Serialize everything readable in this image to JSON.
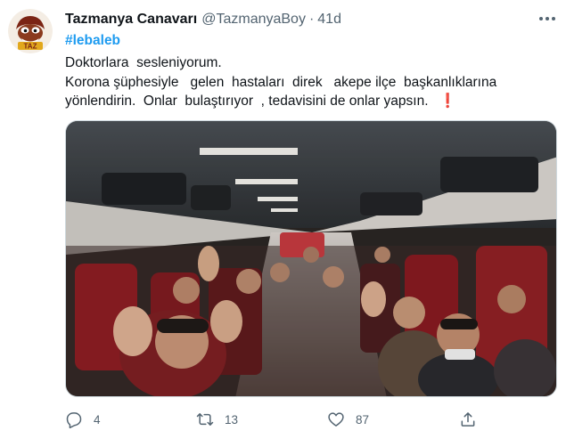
{
  "tweet": {
    "display_name": "Tazmanya Canavarı",
    "handle": "@TazmanyaBoy",
    "separator": "·",
    "time": "41d",
    "hashtag": "#lebaleb",
    "lines": [
      "Doktorlara  sesleniyorum.",
      "Korona şüphesiyle   gelen  hastaları  direk   akepe ilçe  başkanlıklarına",
      "yönlendirin.  Onlar  bulaştırıyor  , tedavisini de onlar yapsın."
    ],
    "emoji": "❗",
    "avatar_text": "TAZ"
  },
  "actions": {
    "reply_count": "4",
    "retweet_count": "13",
    "like_count": "87"
  },
  "icons": {
    "more": "more-dots-icon",
    "reply": "reply-icon",
    "retweet": "retweet-icon",
    "like": "heart-icon",
    "share": "share-icon"
  },
  "colors": {
    "link": "#1d9bf0",
    "muted": "#536471",
    "text": "#0f1419",
    "emoji": "#d0021b"
  }
}
